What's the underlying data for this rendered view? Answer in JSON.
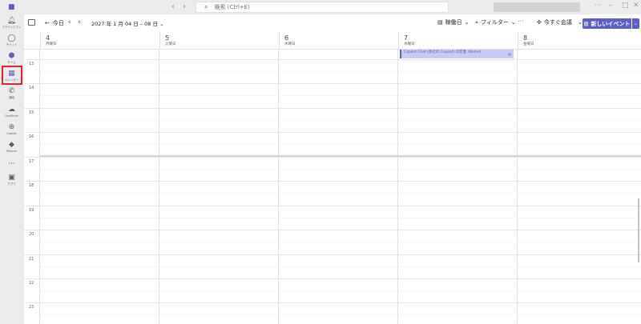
{
  "titlebar": {
    "search_placeholder": "検索 (Ctrl+E)"
  },
  "rail": {
    "items": [
      {
        "label": "アクティビティ",
        "icon": "bell-icon"
      },
      {
        "label": "チャット",
        "icon": "chat-icon"
      },
      {
        "label": "チーム",
        "icon": "teams-icon"
      },
      {
        "label": "カレンダー",
        "icon": "calendar-icon"
      },
      {
        "label": "通話",
        "icon": "phone-icon"
      },
      {
        "label": "OneDrive",
        "icon": "cloud-icon"
      },
      {
        "label": "Copilot",
        "icon": "copilot-icon"
      },
      {
        "label": "Planner",
        "icon": "planner-icon"
      },
      {
        "label": "",
        "icon": "more-icon"
      },
      {
        "label": "アプリ",
        "icon": "apps-icon"
      }
    ]
  },
  "toolbar": {
    "today_label": "今日",
    "date_range": "2027 年 1 月 04 日 – 08 日",
    "view_label": "稼働日",
    "filter_label": "フィルター",
    "more_label": "···",
    "meet_now_label": "今すぐ会議",
    "new_event_label": "新しいイベント"
  },
  "days": [
    {
      "num": "4",
      "name": "月曜日"
    },
    {
      "num": "5",
      "name": "火曜日"
    },
    {
      "num": "6",
      "name": "水曜日"
    },
    {
      "num": "7",
      "name": "木曜日"
    },
    {
      "num": "8",
      "name": "金曜日"
    }
  ],
  "hours": [
    "13",
    "14",
    "15",
    "16",
    "17",
    "18",
    "19",
    "20",
    "21",
    "22",
    "23"
  ],
  "event": {
    "title": "Copilot Chat (会社の Copilot) の定着 (Name)"
  },
  "colors": {
    "accent": "#5b5fc7",
    "highlight": "#e0262c",
    "event_bg": "#c9cbf2"
  }
}
